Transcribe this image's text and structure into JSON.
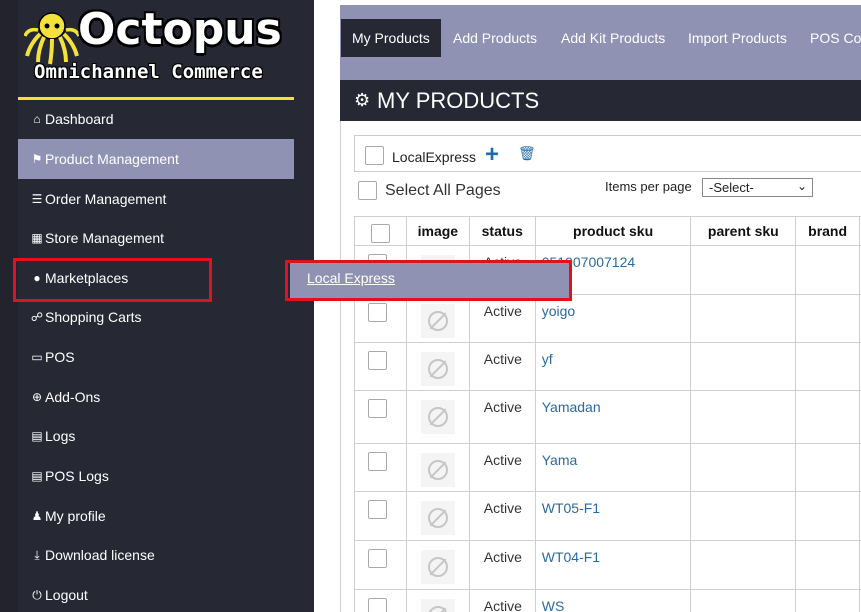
{
  "logo": {
    "title": "Octopus",
    "subtitle": "Omnichannel Commerce"
  },
  "colors": {
    "sidebar": "#262834",
    "accent": "#8f92b2",
    "logo_line": "#f2e23a",
    "highlight": "#e0121d",
    "link": "#2b6aa0"
  },
  "sidebar": {
    "items": [
      {
        "label": "Dashboard",
        "icon": "home-icon"
      },
      {
        "label": "Product Management",
        "icon": "tag-icon",
        "active": true
      },
      {
        "label": "Order Management",
        "icon": "database-icon"
      },
      {
        "label": "Store Management",
        "icon": "cubes-icon"
      },
      {
        "label": "Marketplaces",
        "icon": "globe-icon"
      },
      {
        "label": "Shopping Carts",
        "icon": "cart-icon"
      },
      {
        "label": "POS",
        "icon": "laptop-icon"
      },
      {
        "label": "Add-Ons",
        "icon": "plus-circle-icon"
      },
      {
        "label": "Logs",
        "icon": "file-icon"
      },
      {
        "label": "POS Logs",
        "icon": "file-icon"
      },
      {
        "label": "My profile",
        "icon": "user-icon"
      },
      {
        "label": "Download license",
        "icon": "download-icon"
      },
      {
        "label": "Logout",
        "icon": "power-icon"
      }
    ]
  },
  "flyout": {
    "label": "Local Express"
  },
  "tabs": [
    {
      "label": "My Products",
      "active": true
    },
    {
      "label": "Add Products"
    },
    {
      "label": "Add Kit Products"
    },
    {
      "label": "Import Products"
    },
    {
      "label": "POS Co"
    }
  ],
  "header": {
    "title": "MY PRODUCTS"
  },
  "store": {
    "label": "LocalExpress"
  },
  "select_all": {
    "label": "Select All Pages"
  },
  "items_per_page": {
    "label": "Items per page",
    "selected": "-Select-"
  },
  "table": {
    "columns": [
      "image",
      "status",
      "product sku",
      "parent sku",
      "brand"
    ],
    "rows": [
      {
        "status": "Active",
        "sku": "051907007124"
      },
      {
        "status": "Active",
        "sku": "yoigo"
      },
      {
        "status": "Active",
        "sku": "yf"
      },
      {
        "status": "Active",
        "sku": "Yamadan"
      },
      {
        "status": "Active",
        "sku": "Yama"
      },
      {
        "status": "Active",
        "sku": "WT05-F1"
      },
      {
        "status": "Active",
        "sku": "WT04-F1"
      },
      {
        "status": "Active",
        "sku": "WS"
      }
    ]
  }
}
